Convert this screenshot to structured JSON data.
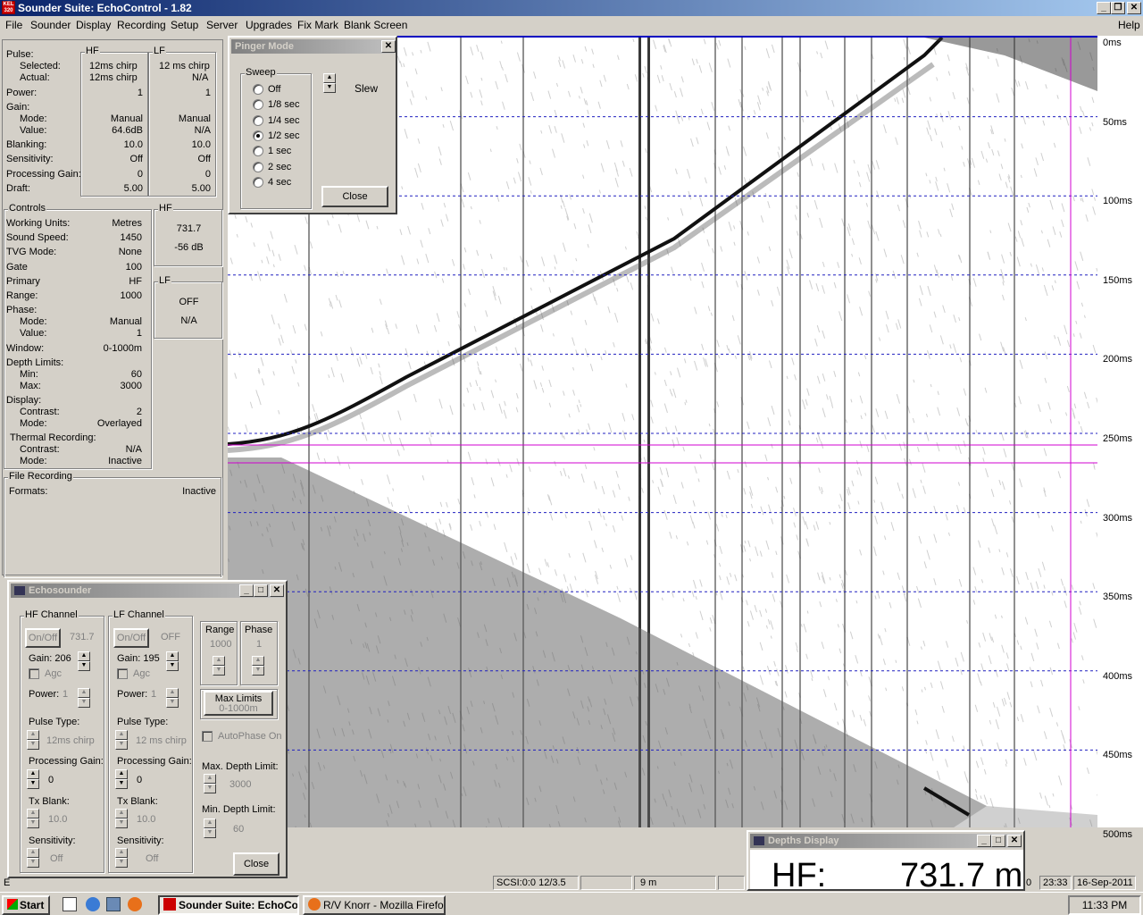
{
  "app": {
    "title": "Sounder Suite: EchoControl - 1.82",
    "icon_text": "KEL 320"
  },
  "menu": [
    "File",
    "Sounder",
    "Display",
    "Recording",
    "Setup",
    "Server",
    "Upgrades",
    "Fix Mark",
    "Blank Screen"
  ],
  "menu_help": "Help",
  "pulse": {
    "label": "Pulse:",
    "hf_header": "HF",
    "lf_header": "LF",
    "rows": [
      {
        "label": "Selected:",
        "hf": "12ms chirp",
        "lf": "12 ms chirp"
      },
      {
        "label": "Actual:",
        "hf": "12ms chirp",
        "lf": "N/A"
      },
      {
        "label": "Power:",
        "hf": "1",
        "lf": "1"
      },
      {
        "label": "Gain:",
        "hf": "",
        "lf": ""
      },
      {
        "label": "Mode:",
        "hf": "Manual",
        "lf": "Manual"
      },
      {
        "label": "Value:",
        "hf": "64.6dB",
        "lf": "N/A"
      },
      {
        "label": "Blanking:",
        "hf": "10.0",
        "lf": "10.0"
      },
      {
        "label": "Sensitivity:",
        "hf": "Off",
        "lf": "Off"
      },
      {
        "label": "Processing Gain:",
        "hf": "0",
        "lf": "0"
      },
      {
        "label": "Draft:",
        "hf": "5.00",
        "lf": "5.00"
      }
    ]
  },
  "controls": {
    "header": "Controls",
    "rows": [
      {
        "label": "Working Units:",
        "value": "Metres"
      },
      {
        "label": "Sound Speed:",
        "value": "1450"
      },
      {
        "label": "TVG Mode:",
        "value": "None"
      },
      {
        "label": "Gate",
        "value": "100"
      },
      {
        "label": "Primary",
        "value": "HF"
      },
      {
        "label": "Range:",
        "value": "1000"
      },
      {
        "label": "Phase:",
        "value": ""
      },
      {
        "label": "Mode:",
        "value": "Manual"
      },
      {
        "label": "Value:",
        "value": "1"
      },
      {
        "label": "Window:",
        "value": "0-1000m"
      },
      {
        "label": "Depth Limits:",
        "value": ""
      },
      {
        "label": "Min:",
        "value": "60"
      },
      {
        "label": "Max:",
        "value": "3000"
      },
      {
        "label": "Display:",
        "value": ""
      },
      {
        "label": "Contrast:",
        "value": "2"
      },
      {
        "label": "Mode:",
        "value": "Overlayed"
      },
      {
        "label": "Thermal Recording:",
        "value": ""
      },
      {
        "label": "Contrast:",
        "value": "N/A"
      },
      {
        "label": "Mode:",
        "value": "Inactive"
      }
    ]
  },
  "hf_box": {
    "header": "HF",
    "depth": "731.7",
    "level": "-56 dB"
  },
  "lf_box": {
    "header": "LF",
    "state": "OFF",
    "level": "N/A"
  },
  "file_recording": {
    "header": "File Recording",
    "label": "Formats:",
    "value": "Inactive"
  },
  "scale": {
    "ticks": [
      "0ms",
      "50ms",
      "100ms",
      "150ms",
      "200ms",
      "250ms",
      "300ms",
      "350ms",
      "400ms",
      "450ms",
      "500ms"
    ]
  },
  "pinger": {
    "title": "Pinger Mode",
    "group": "Sweep",
    "options": [
      "Off",
      "1/8 sec",
      "1/4 sec",
      "1/2 sec",
      "1 sec",
      "2 sec",
      "4 sec"
    ],
    "selected_index": 3,
    "slew_label": "Slew",
    "close_label": "Close"
  },
  "echosounder": {
    "title": "Echosounder",
    "hf": {
      "header": "HF Channel",
      "onoff": "On/Off",
      "value": "731.7",
      "gain_label": "Gain: 206",
      "agc": "Agc",
      "power_label": "Power:",
      "power": "1",
      "pulse_type_label": "Pulse Type:",
      "pulse_type": "12ms chirp",
      "proc_gain_label": "Processing Gain:",
      "proc_gain": "0",
      "tx_blank_label": "Tx Blank:",
      "tx_blank": "10.0",
      "sensitivity_label": "Sensitivity:",
      "sensitivity": "Off"
    },
    "lf": {
      "header": "LF Channel",
      "onoff": "On/Off",
      "value": "OFF",
      "gain_label": "Gain: 195",
      "agc": "Agc",
      "power_label": "Power:",
      "power": "1",
      "pulse_type_label": "Pulse Type:",
      "pulse_type": "12 ms chirp",
      "proc_gain_label": "Processing Gain:",
      "proc_gain": "0",
      "tx_blank_label": "Tx Blank:",
      "tx_blank": "10.0",
      "sensitivity_label": "Sensitivity:",
      "sensitivity": "Off"
    },
    "range_label": "Range",
    "range": "1000",
    "phase_label": "Phase",
    "phase": "1",
    "max_limits_label": "Max Limits",
    "max_limits": "0-1000m",
    "autophase": "AutoPhase On",
    "max_depth_label": "Max. Depth Limit:",
    "max_depth": "3000",
    "min_depth_label": "Min. Depth Limit:",
    "min_depth": "60",
    "close_label": "Close"
  },
  "depths": {
    "title": "Depths Display",
    "label": "HF:",
    "value": "731.7 m"
  },
  "status": {
    "scsi": "SCSI:0:0  12/3.5",
    "depth": "9 m",
    "time": "23:33",
    "date": "16-Sep-2011",
    "left_fragment": "E",
    "right_fragment": "0"
  },
  "taskbar": {
    "start": "Start",
    "items": [
      "Sounder Suite: EchoCo...",
      "R/V Knorr - Mozilla Firefox"
    ],
    "clock": "11:33 PM"
  }
}
